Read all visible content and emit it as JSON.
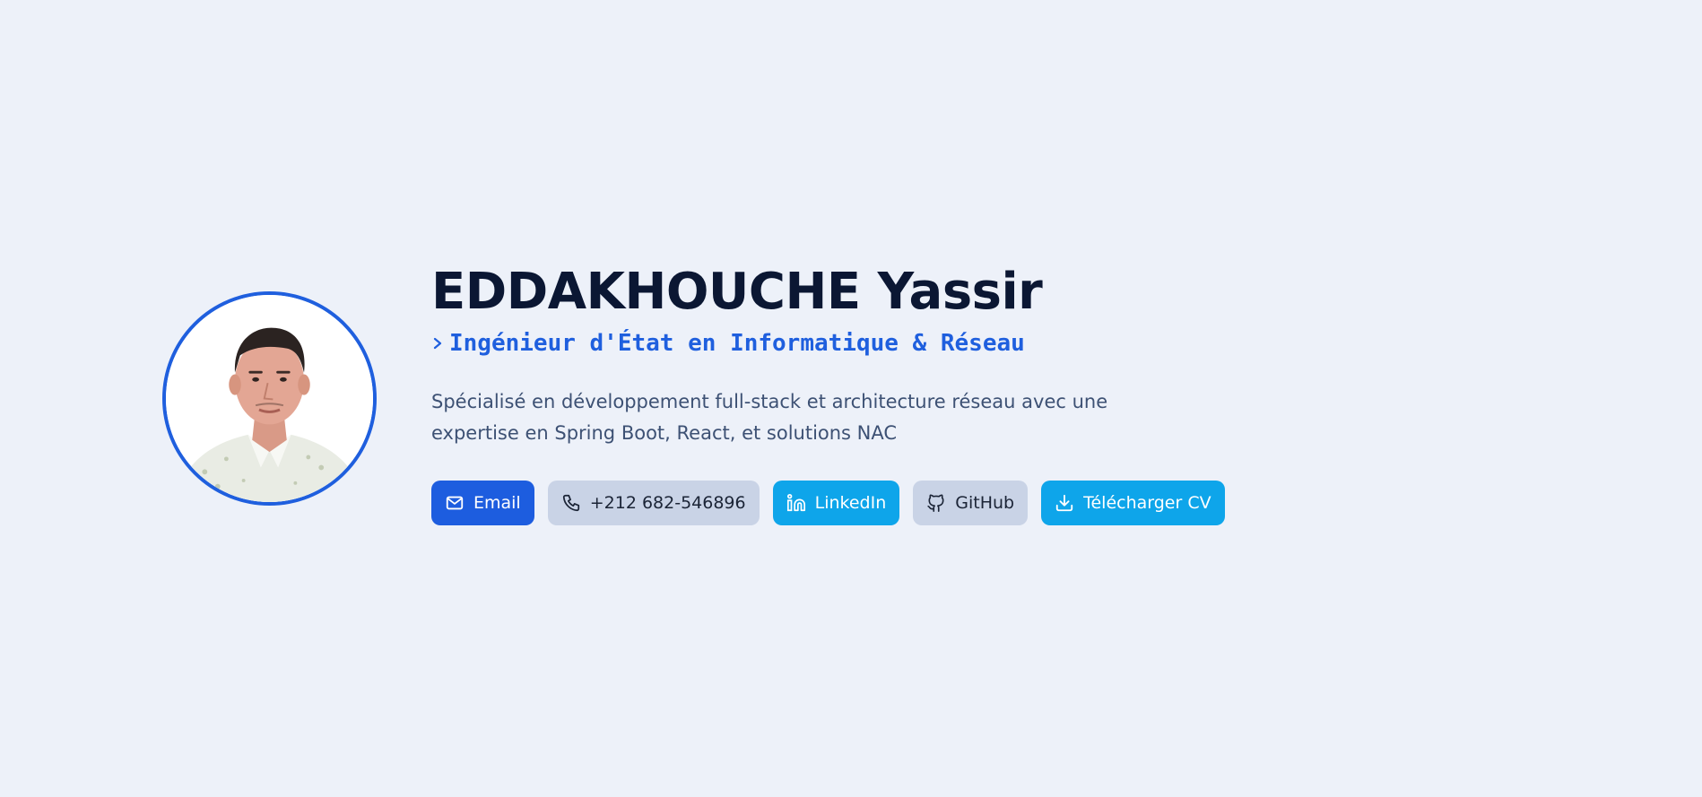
{
  "profile": {
    "name": "EDDAKHOUCHE Yassir",
    "role": "Ingénieur d'État en Informatique & Réseau",
    "description": "Spécialisé en développement full-stack et architecture réseau avec une expertise en Spring Boot, React, et solutions NAC"
  },
  "actions": {
    "email": {
      "label": "Email",
      "icon": "mail-icon"
    },
    "phone": {
      "label": "+212 682-546896",
      "icon": "phone-icon"
    },
    "linkedin": {
      "label": "LinkedIn",
      "icon": "linkedin-icon"
    },
    "github": {
      "label": "GitHub",
      "icon": "github-icon"
    },
    "cv": {
      "label": "Télécharger CV",
      "icon": "download-icon"
    }
  },
  "colors": {
    "background": "#edf1f9",
    "primary": "#1d5ddf",
    "sky": "#0ea5ea",
    "grey_button": "#c9d3e6",
    "heading": "#0b1733",
    "text": "#3d5174"
  }
}
